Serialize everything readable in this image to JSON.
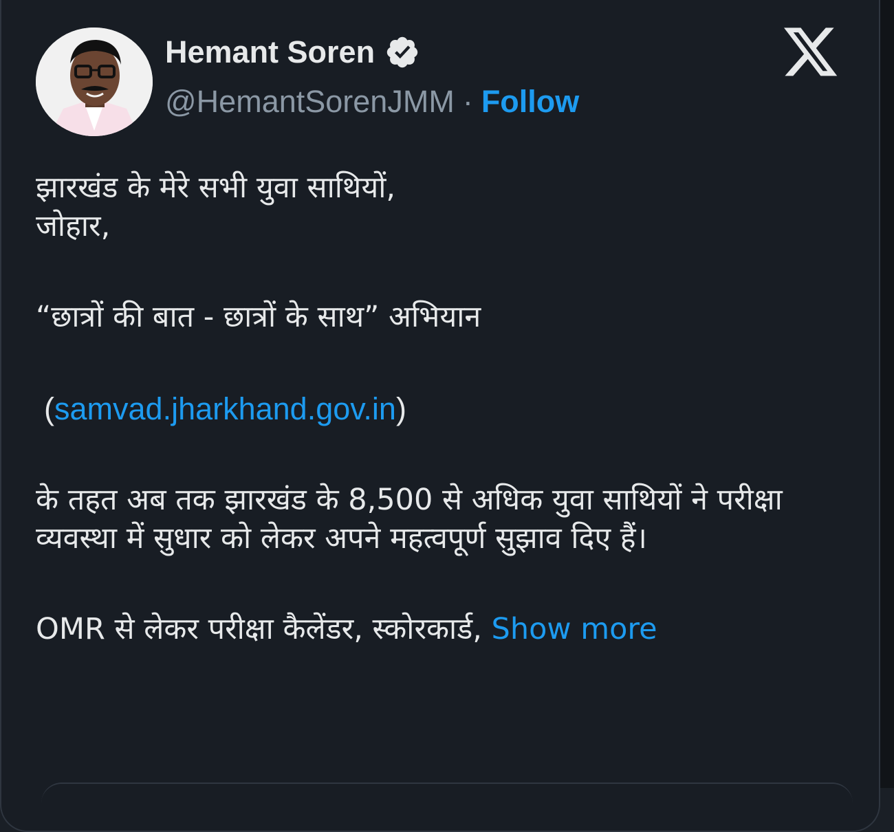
{
  "author": {
    "name": "Hemant Soren",
    "handle": "@HemantSorenJMM",
    "separator": "·",
    "follow_label": "Follow"
  },
  "icons": {
    "verified": "verified-badge-icon",
    "logo": "x-logo-icon",
    "avatar": "avatar-photo"
  },
  "tweet": {
    "line1": "झारखंड के मेरे सभी युवा साथियों,",
    "line2": "जोहार,",
    "line3": "“छात्रों की बात - छात्रों के साथ” अभियान",
    "url_open": "(",
    "url": "samvad.jharkhand.gov.in",
    "url_close": ")",
    "para": "के तहत अब तक झारखंड के 8,500 से अधिक युवा साथियों ने परीक्षा व्यवस्था में सुधार को लेकर अपने महत्वपूर्ण सुझाव दिए हैं।",
    "last_line": "OMR से लेकर परीक्षा कैलेंडर, स्कोरकार्ड, ",
    "show_more": "Show more"
  },
  "colors": {
    "background": "#181d24",
    "text": "#e7e9ea",
    "secondary": "#8b98a5",
    "accent": "#1d9bf0"
  }
}
